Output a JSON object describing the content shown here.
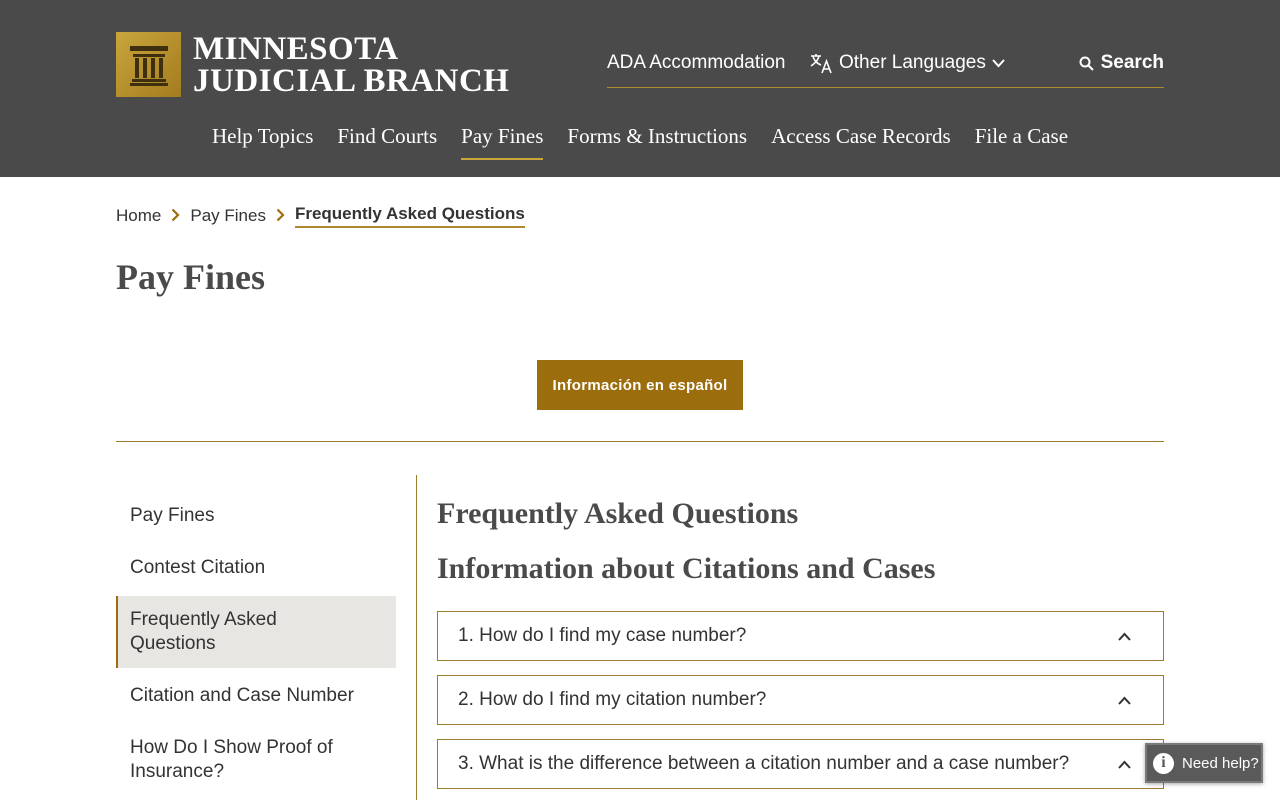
{
  "header": {
    "logo_line1": "MINNESOTA",
    "logo_line2": "JUDICIAL BRANCH",
    "ada_label": "ADA Accommodation",
    "languages_label": "Other Languages",
    "search_label": "Search",
    "nav": [
      {
        "label": "Help Topics",
        "active": false
      },
      {
        "label": "Find Courts",
        "active": false
      },
      {
        "label": "Pay Fines",
        "active": true
      },
      {
        "label": "Forms & Instructions",
        "active": false
      },
      {
        "label": "Access Case Records",
        "active": false
      },
      {
        "label": "File a Case",
        "active": false
      }
    ]
  },
  "breadcrumb": {
    "home": "Home",
    "parent": "Pay Fines",
    "current": "Frequently Asked Questions"
  },
  "page": {
    "title": "Pay Fines",
    "spanish_button": "Información en español"
  },
  "sidebar": {
    "items": [
      {
        "label": "Pay Fines",
        "active": false
      },
      {
        "label": "Contest Citation",
        "active": false
      },
      {
        "label": "Frequently Asked Questions",
        "active": true
      },
      {
        "label": "Citation and Case Number",
        "active": false
      },
      {
        "label": "How Do I Show Proof of Insurance?",
        "active": false
      }
    ]
  },
  "content": {
    "heading": "Frequently Asked Questions",
    "subheading": "Information about Citations and Cases",
    "questions": [
      {
        "label": "1. How do I find my case number?"
      },
      {
        "label": "2. How do I find my citation number?"
      },
      {
        "label": "3. What is the difference between a citation number and a case number?"
      }
    ]
  },
  "help_widget": {
    "label": "Need help?"
  },
  "colors": {
    "header_bg": "#4a4a4a",
    "accent_gold": "#9c6d0d",
    "active_sidebar_bg": "#e8e6e3"
  }
}
